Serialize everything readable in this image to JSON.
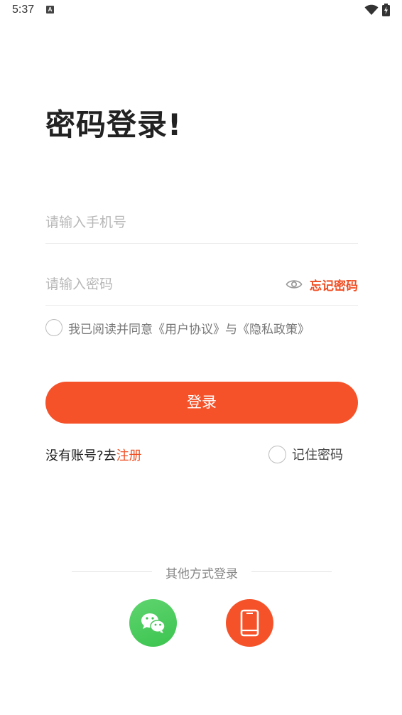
{
  "status_bar": {
    "time": "5:37",
    "notification_glyph": "A",
    "icons": [
      "wifi-icon",
      "battery-icon"
    ]
  },
  "page": {
    "title": "密码登录!"
  },
  "form": {
    "phone_placeholder": "请输入手机号",
    "phone_value": "",
    "password_placeholder": "请输入密码",
    "password_value": "",
    "forgot_password": "忘记密码",
    "agreement_prefix": "我已阅读并同意",
    "user_agreement": "《用户协议》",
    "agreement_join": "与",
    "privacy_policy": "《隐私政策》",
    "agreement_checked": false
  },
  "actions": {
    "login": "登录",
    "no_account": "没有账号?去",
    "register": "注册",
    "remember_password": "记住密码",
    "remember_checked": false
  },
  "other_login": {
    "label": "其他方式登录",
    "options": [
      "wechat-icon",
      "phone-icon"
    ]
  },
  "colors": {
    "accent": "#f5522a",
    "link": "#f04e23",
    "wechat": "#3cc44f",
    "placeholder": "#b8b8b8"
  }
}
